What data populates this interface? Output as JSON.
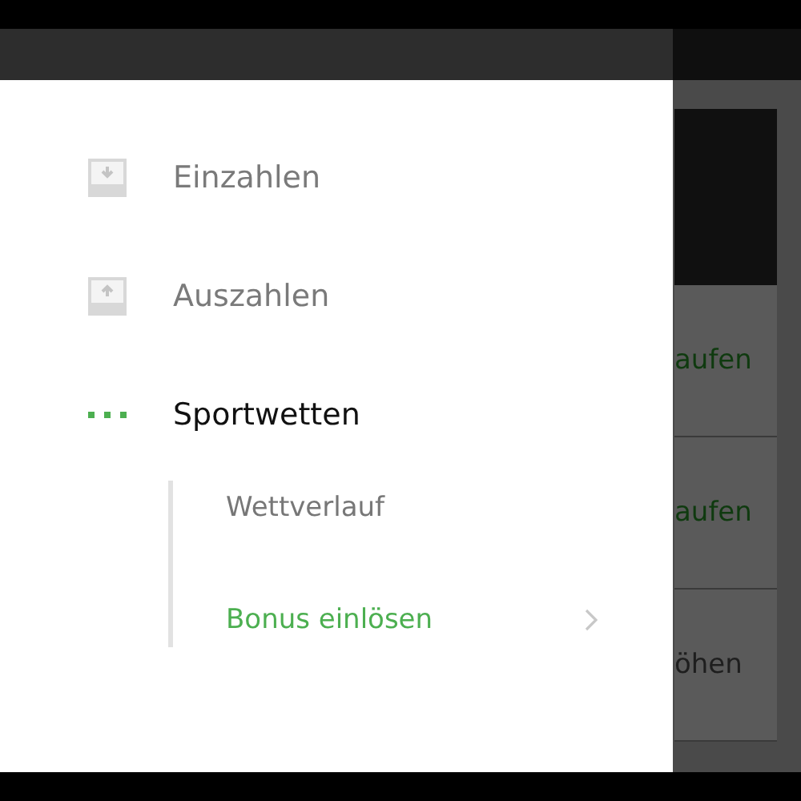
{
  "menu": {
    "items": [
      {
        "label": "Einzahlen",
        "kind": "deposit",
        "selected": false
      },
      {
        "label": "Auszahlen",
        "kind": "withdraw",
        "selected": false
      },
      {
        "label": "Sportwetten",
        "kind": "sports",
        "selected": true
      }
    ],
    "subitems": [
      {
        "label": "Wettverlauf",
        "selected": false,
        "chevron": false
      },
      {
        "label": "Bonus einlösen",
        "selected": true,
        "chevron": true
      }
    ]
  },
  "background_cards": [
    {
      "label": "aufen",
      "kind": "link"
    },
    {
      "label": "aufen",
      "kind": "link"
    },
    {
      "label": "öhen",
      "kind": "muted"
    }
  ]
}
